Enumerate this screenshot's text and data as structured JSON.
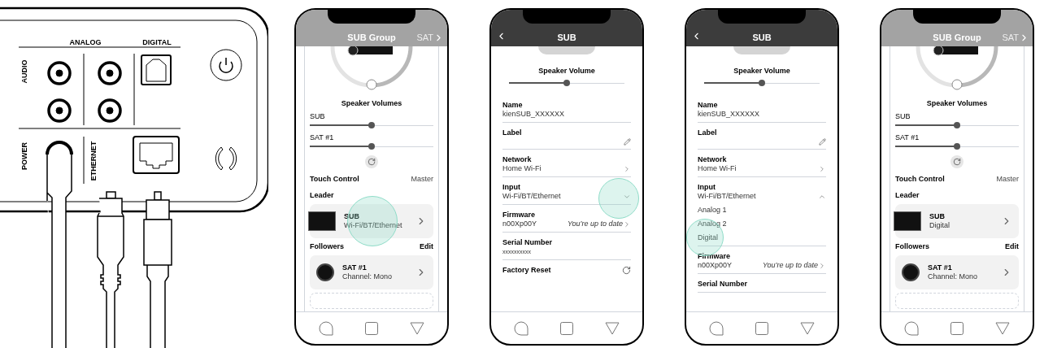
{
  "device_panel": {
    "analog_label": "ANALOG",
    "digital_label": "DIGITAL",
    "audio_label": "AUDIO",
    "power_label": "POWER",
    "ethernet_label": "ETHERNET"
  },
  "phones": [
    {
      "kind": "group",
      "title": "SUB Group",
      "next": "SAT",
      "volumes_title": "Speaker Volumes",
      "volumes": [
        {
          "label": "SUB",
          "level": 0.5
        },
        {
          "label": "SAT #1",
          "level": 0.5
        }
      ],
      "touch_control": {
        "label": "Touch Control",
        "value": "Master"
      },
      "leader_title": "Leader",
      "leader": {
        "name": "SUB",
        "input": "Wi-Fi/BT/Ethernet",
        "touched": true
      },
      "followers_title": "Followers",
      "edit": "Edit",
      "followers": [
        {
          "name": "SAT #1",
          "channel": "Channel: Mono",
          "touched": false
        }
      ]
    },
    {
      "kind": "detail",
      "title": "SUB",
      "volume_title": "Speaker Volume",
      "level": 0.5,
      "fields": [
        {
          "kind": "text",
          "label": "Name",
          "value": "kienSUB_XXXXXX"
        },
        {
          "kind": "edit",
          "label": "Label"
        },
        {
          "kind": "link",
          "label": "Network",
          "value": "Home Wi-Fi"
        },
        {
          "kind": "dropdown",
          "label": "Input",
          "value": "Wi-Fi/BT/Ethernet",
          "expanded": false,
          "touched": true
        },
        {
          "kind": "link",
          "label": "Firmware",
          "value": "n00Xp00Y",
          "note": "You’re up to date"
        },
        {
          "kind": "text",
          "label": "Serial Number",
          "value": "xxxxxxxxxx"
        },
        {
          "kind": "reset",
          "label": "Factory Reset"
        }
      ]
    },
    {
      "kind": "detail",
      "title": "SUB",
      "volume_title": "Speaker Volume",
      "level": 0.5,
      "fields": [
        {
          "kind": "text",
          "label": "Name",
          "value": "kienSUB_XXXXXX"
        },
        {
          "kind": "edit",
          "label": "Label"
        },
        {
          "kind": "link",
          "label": "Network",
          "value": "Home Wi-Fi"
        },
        {
          "kind": "dropdown",
          "label": "Input",
          "value": "Wi-Fi/BT/Ethernet",
          "expanded": true,
          "options": [
            {
              "label": "Analog 1",
              "touched": false
            },
            {
              "label": "Analog 2",
              "touched": false
            },
            {
              "label": "Digital",
              "touched": true
            }
          ]
        },
        {
          "kind": "link",
          "label": "Firmware",
          "value": "n00Xp00Y",
          "note": "You’re up to date"
        },
        {
          "kind": "text",
          "label": "Serial Number"
        }
      ]
    },
    {
      "kind": "group",
      "title": "SUB Group",
      "next": "SAT",
      "volumes_title": "Speaker Volumes",
      "volumes": [
        {
          "label": "SUB",
          "level": 0.5
        },
        {
          "label": "SAT #1",
          "level": 0.5
        }
      ],
      "touch_control": {
        "label": "Touch Control",
        "value": "Master"
      },
      "leader_title": "Leader",
      "leader": {
        "name": "SUB",
        "input": "Digital",
        "touched": false
      },
      "followers_title": "Followers",
      "edit": "Edit",
      "followers": [
        {
          "name": "SAT #1",
          "channel": "Channel: Mono",
          "touched": false
        }
      ]
    }
  ]
}
